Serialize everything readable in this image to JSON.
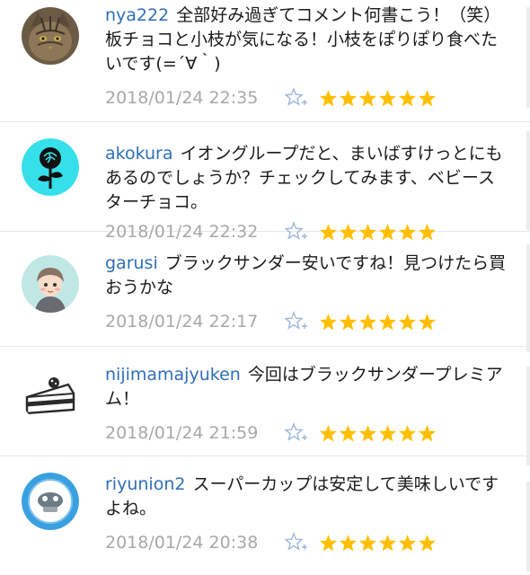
{
  "comments": [
    {
      "username": "nya222",
      "text": "全部好み過ぎてコメント何書こう！（笑）板チョコと小枝が気になる！小枝をぽりぽり食べたいです(=´∀｀)",
      "timestamp": "2018/01/24 22:35",
      "rating": 6,
      "avatar": "cat-photo"
    },
    {
      "username": "akokura",
      "text": "イオングループだと、まいばすけっとにもあるのでしょうか？チェックしてみます、ベビースターチョコ。",
      "timestamp": "2018/01/24 22:32",
      "rating": 6,
      "avatar": "rose-icon"
    },
    {
      "username": "garusi",
      "text": "ブラックサンダー安いですね！見つけたら買おうかな",
      "timestamp": "2018/01/24 22:17",
      "rating": 6,
      "avatar": "character-illustration"
    },
    {
      "username": "nijimamajyuken",
      "text": "今回はブラックサンダープレミアム！",
      "timestamp": "2018/01/24 21:59",
      "rating": 6,
      "avatar": "cake-slice-icon"
    },
    {
      "username": "riyunion2",
      "text": "スーパーカップは安定して美味しいですよね。",
      "timestamp": "2018/01/24 20:38",
      "rating": 6,
      "avatar": "badge-logo"
    }
  ],
  "colors": {
    "username": "#2f6fb6",
    "timestamp": "#a8a8a8",
    "star_filled": "#ffbf00",
    "star_add": "#9cb8dd"
  }
}
